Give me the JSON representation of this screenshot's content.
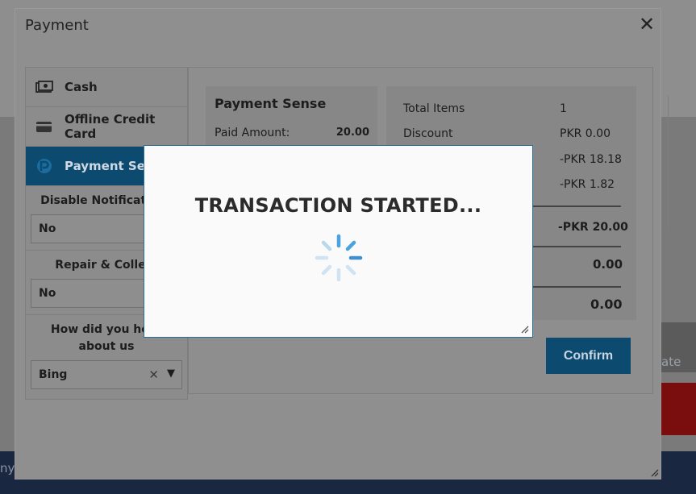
{
  "dialog": {
    "title": "Payment",
    "close_glyph": "✕"
  },
  "methods": [
    {
      "label": "Cash",
      "icon": "cash-icon"
    },
    {
      "label": "Offline Credit Card",
      "icon": "credit-card-icon"
    },
    {
      "label": "Payment Sense",
      "icon": "payment-sense-icon"
    }
  ],
  "fields": {
    "disable_notifications": {
      "label": "Disable Notifications",
      "value": "No"
    },
    "repair_collect": {
      "label": "Repair & Collect",
      "value": "No"
    },
    "hear_about": {
      "label": "How did you hear about us",
      "value": "Bing"
    }
  },
  "payment_sense": {
    "title": "Payment Sense",
    "paid_label": "Paid Amount:",
    "paid_value": "20.00"
  },
  "summary": {
    "total_items_label": "Total Items",
    "total_items_value": "1",
    "discount_label": "Discount",
    "discount_value": "PKR 0.00",
    "row3_value": "-PKR 18.18",
    "row4_value": "-PKR 1.82",
    "total_value": "-PKR 20.00",
    "paid_value": "0.00",
    "due_value": "0.00"
  },
  "confirm_label": "Confirm",
  "modal": {
    "title": "TRANSACTION STARTED..."
  },
  "background": {
    "right_text": "ate",
    "left_text": "ny"
  },
  "colors": {
    "accent": "#0c4a70",
    "spinner": "#4aa3df"
  }
}
